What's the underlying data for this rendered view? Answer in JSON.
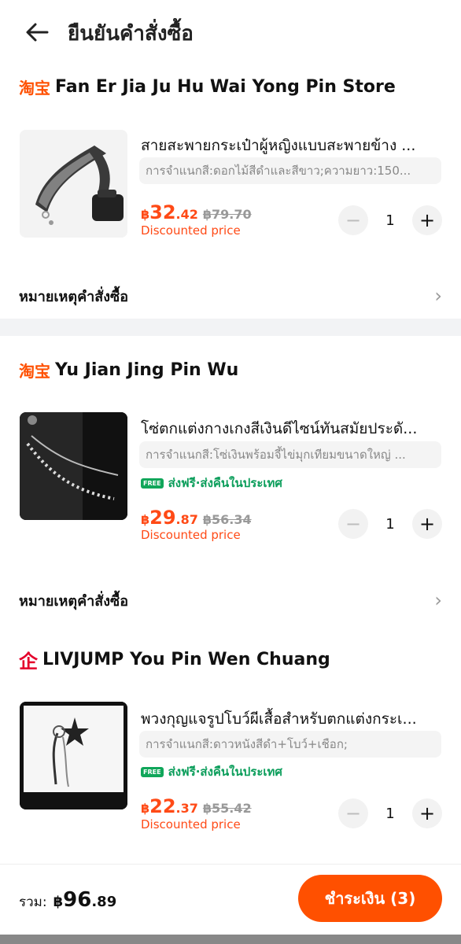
{
  "header": {
    "title": "ยืนยันคำสั่งซื้อ"
  },
  "stores": [
    {
      "platform": "淘宝",
      "name": "Fan Er Jia Ju Hu Wai Yong Pin Store",
      "item": {
        "title": "สายสะพายกระเป๋าผู้หญิงแบบสะพายข้าง ...",
        "variant": "การจำแนกสี:ดอกไม้สีดำและสีขาว;ความยาว:150...",
        "price_currency": "฿",
        "price_main": "32",
        "price_decimal": ".42",
        "price_old": "฿79.70",
        "price_label": "Discounted price",
        "quantity": "1"
      },
      "note_label": "หมายเหตุคำสั่งซื้อ"
    },
    {
      "platform": "淘宝",
      "name": "Yu Jian Jing Pin Wu",
      "item": {
        "title": "โซ่ตกแต่งกางเกงสีเงินดีไซน์ทันสมัยประดั...",
        "variant": "การจำแนกสี:โซ่เงินพร้อมจี้ไข่มุกเทียมขนาดใหญ่ ...",
        "shipping": "ส่งฟรี·ส่งคืนในประเทศ",
        "free_badge": "FREE",
        "price_currency": "฿",
        "price_main": "29",
        "price_decimal": ".87",
        "price_old": "฿56.34",
        "price_label": "Discounted price",
        "quantity": "1"
      },
      "note_label": "หมายเหตุคำสั่งซื้อ"
    },
    {
      "platform": "企",
      "name": "LIVJUMP You Pin Wen Chuang",
      "item": {
        "title": "พวงกุญแจรูปโบว์ผีเสื้อสำหรับตกแต่งกระเ...",
        "variant": "การจำแนกสี:ดาวหนังสีดำ+โบว์+เชือก;",
        "shipping": "ส่งฟรี·ส่งคืนในประเทศ",
        "free_badge": "FREE",
        "price_currency": "฿",
        "price_main": "22",
        "price_decimal": ".37",
        "price_old": "฿55.42",
        "price_label": "Discounted price",
        "quantity": "1"
      }
    }
  ],
  "footer": {
    "total_label": "รวม:",
    "total_currency": "฿",
    "total_main": "96",
    "total_decimal": ".89",
    "pay_button": "ชำระเงิน (3)"
  },
  "colors": {
    "accent": "#ff5000",
    "price": "#ff4a16",
    "shipping": "#0a9d5a"
  },
  "icons": [
    "back-arrow-icon",
    "minus-icon",
    "plus-icon",
    "chevron-right-icon",
    "free-shipping-icon"
  ]
}
